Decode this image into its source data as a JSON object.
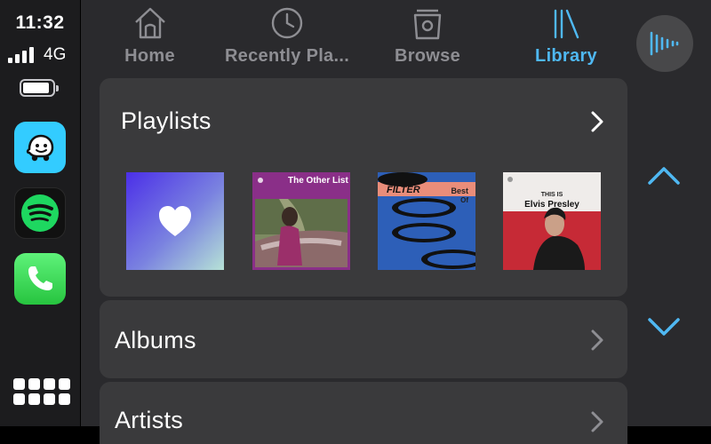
{
  "status": {
    "time": "11:32",
    "network": "4G"
  },
  "dock": {
    "apps": [
      {
        "name": "Waze",
        "icon": "waze-icon",
        "color": "#33ccff"
      },
      {
        "name": "Spotify",
        "icon": "spotify-icon",
        "color": "#1ed760"
      },
      {
        "name": "Phone",
        "icon": "phone-icon",
        "color": "#34c759"
      }
    ],
    "app_grid_icon": "app-grid-icon"
  },
  "tabs": [
    {
      "label": "Home",
      "icon": "home-icon",
      "active": false
    },
    {
      "label": "Recently Pla...",
      "icon": "clock-icon",
      "active": false
    },
    {
      "label": "Browse",
      "icon": "browse-icon",
      "active": false
    },
    {
      "label": "Library",
      "icon": "library-icon",
      "active": true
    }
  ],
  "accent_color": "#4fb8f2",
  "siri_icon": "siri-waveform-icon",
  "sections": {
    "playlists": {
      "title": "Playlists",
      "items": [
        {
          "art": "liked-songs-heart"
        },
        {
          "title": "The Other List"
        },
        {
          "title": "FILTER",
          "badge_top": "Best",
          "badge_bottom": "Of"
        },
        {
          "subtitle": "THIS IS",
          "title": "Elvis Presley"
        }
      ]
    },
    "albums": {
      "title": "Albums"
    },
    "artists": {
      "title": "Artists"
    }
  }
}
